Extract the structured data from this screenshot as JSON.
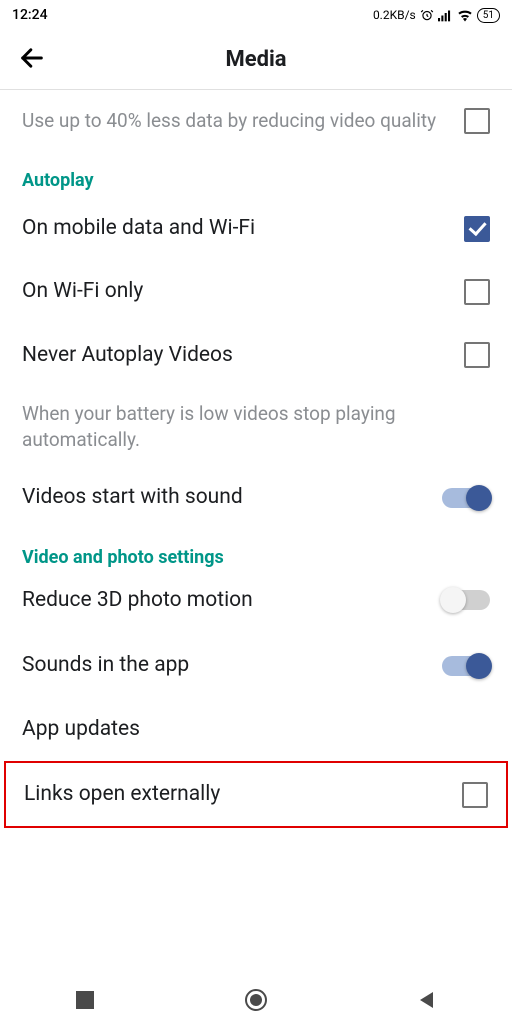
{
  "statusBar": {
    "time": "12:24",
    "speed": "0.2KB/s",
    "battery": "51"
  },
  "header": {
    "title": "Media"
  },
  "dataQuality": {
    "label": "Use up to 40% less data by reducing video quality"
  },
  "autoplay": {
    "section": "Autoplay",
    "opt1": "On mobile data and Wi-Fi",
    "opt2": "On Wi-Fi only",
    "opt3": "Never Autoplay Videos",
    "note": "When your battery is low videos stop playing automatically."
  },
  "videoSound": {
    "label": "Videos start with sound"
  },
  "videoPhoto": {
    "section": "Video and photo settings",
    "reduce3d": "Reduce 3D photo motion",
    "sounds": "Sounds in the app",
    "updates": "App updates",
    "linksExternal": "Links open externally"
  }
}
